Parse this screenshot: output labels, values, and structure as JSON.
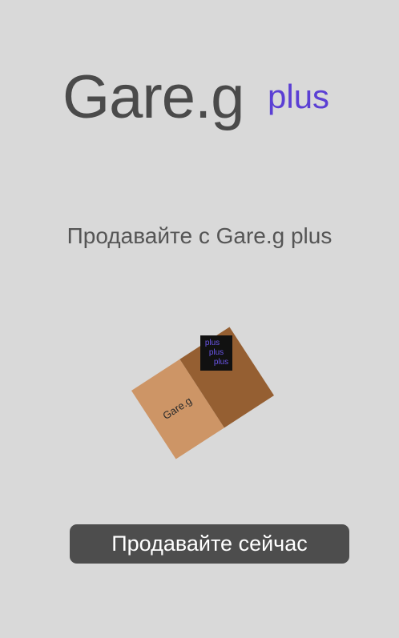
{
  "logo": {
    "main": "Gare.g",
    "sup": "plus"
  },
  "tagline": "Продавайте с Gare.g plus",
  "box": {
    "label": "Gare.g",
    "tag_lines": [
      "plus",
      "plus",
      "plus"
    ]
  },
  "cta": {
    "label": "Продавайте сейчас"
  },
  "colors": {
    "background": "#d9d9d9",
    "logo_text": "#4a4a4a",
    "accent": "#5b3fd4",
    "box_light": "#cd9566",
    "box_dark": "#955f32",
    "tag_bg": "#111111",
    "button_bg": "#4d4d4d"
  }
}
